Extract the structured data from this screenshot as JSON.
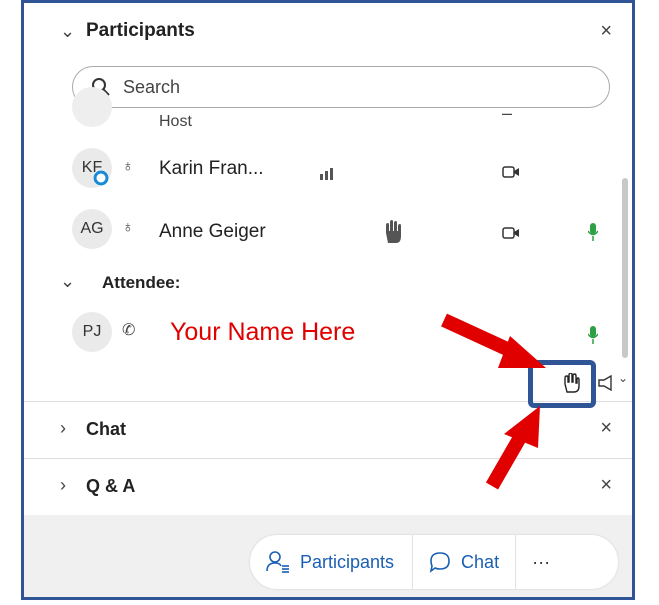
{
  "participants": {
    "header_title": "Participants",
    "close_glyph": "×",
    "search_placeholder": "Search",
    "host_row": {
      "role": "Host"
    },
    "rows": [
      {
        "initials": "KF",
        "name": "Karin Fran...",
        "name_display": "Karin Fran..."
      },
      {
        "initials": "AG",
        "name": "Anne Geiger"
      }
    ],
    "attendee_header": "Attendee:",
    "attendee": {
      "initials": "PJ"
    }
  },
  "annotation": {
    "your_name": "Your Name Here"
  },
  "sections": {
    "chat": "Chat",
    "qa": "Q & A"
  },
  "footer": {
    "participants_label": "Participants",
    "chat_label": "Chat",
    "more_label": "···"
  },
  "colors": {
    "frame_border": "#2f5597",
    "accent_blue": "#1a5fb4",
    "mic_green": "#2ea043",
    "annotation_red": "#e00000"
  }
}
